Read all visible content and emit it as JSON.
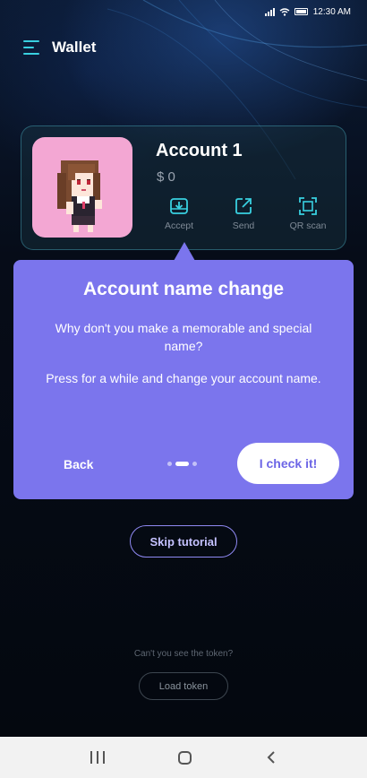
{
  "status_bar": {
    "time": "12:30 AM"
  },
  "header": {
    "title": "Wallet",
    "menu_icon": "hamburger-menu-icon"
  },
  "account": {
    "name": "Account 1",
    "balance": "$ 0",
    "actions": [
      {
        "label": "Accept",
        "icon": "download-tray-icon"
      },
      {
        "label": "Send",
        "icon": "external-link-icon"
      },
      {
        "label": "QR scan",
        "icon": "scan-frame-icon"
      }
    ]
  },
  "tooltip": {
    "title": "Account name change",
    "description_1": "Why don't you make a memorable and special name?",
    "description_2": "Press for a while and change your account name.",
    "back_label": "Back",
    "confirm_label": "I check it!",
    "page_count": 3,
    "active_page": 2
  },
  "skip_label": "Skip tutorial",
  "token": {
    "hint": "Can't you see the token?",
    "load_label": "Load token"
  },
  "colors": {
    "accent_cyan": "#39d0e0",
    "tooltip_purple": "#7b75ed",
    "background": "#050a12"
  }
}
